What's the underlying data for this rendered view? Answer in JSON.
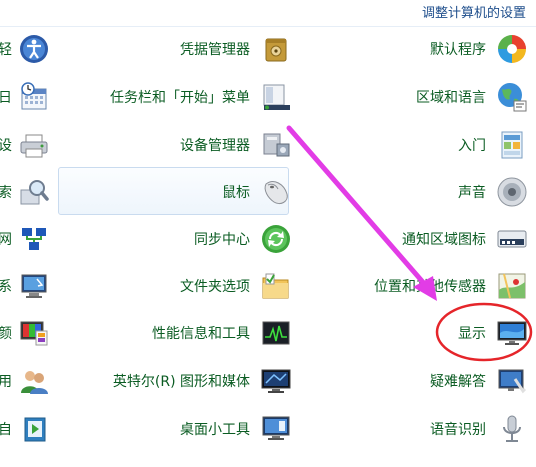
{
  "header": {
    "title": "调整计算机的设置"
  },
  "right_column": [
    {
      "label": "默认程序",
      "icon": "default-programs-icon"
    },
    {
      "label": "区域和语言",
      "icon": "region-language-icon"
    },
    {
      "label": "入门",
      "icon": "getting-started-icon"
    },
    {
      "label": "声音",
      "icon": "sound-icon"
    },
    {
      "label": "通知区域图标",
      "icon": "notification-area-icon"
    },
    {
      "label": "位置和其他传感器",
      "icon": "location-sensors-icon"
    },
    {
      "label": "显示",
      "icon": "display-icon"
    },
    {
      "label": "疑难解答",
      "icon": "troubleshooting-icon"
    },
    {
      "label": "语音识别",
      "icon": "speech-recognition-icon"
    }
  ],
  "middle_column": [
    {
      "label": "凭据管理器",
      "icon": "credential-manager-icon"
    },
    {
      "label": "任务栏和「开始」菜单",
      "icon": "taskbar-start-menu-icon"
    },
    {
      "label": "设备管理器",
      "icon": "device-manager-icon"
    },
    {
      "label": "鼠标",
      "icon": "mouse-icon"
    },
    {
      "label": "同步中心",
      "icon": "sync-center-icon"
    },
    {
      "label": "文件夹选项",
      "icon": "folder-options-icon"
    },
    {
      "label": "性能信息和工具",
      "icon": "performance-tools-icon"
    },
    {
      "label": "英特尔(R) 图形和媒体",
      "icon": "intel-graphics-icon"
    },
    {
      "label": "桌面小工具",
      "icon": "desktop-gadgets-icon"
    }
  ],
  "left_column": [
    {
      "label": "轻",
      "icon": "ease-of-access-icon"
    },
    {
      "label": "日",
      "icon": "date-time-icon"
    },
    {
      "label": "设",
      "icon": "devices-printers-icon"
    },
    {
      "label": "索",
      "icon": "indexing-options-icon"
    },
    {
      "label": "网",
      "icon": "network-sharing-icon"
    },
    {
      "label": "系",
      "icon": "system-icon"
    },
    {
      "label": "颜",
      "icon": "color-management-icon"
    },
    {
      "label": "用",
      "icon": "user-accounts-icon"
    },
    {
      "label": "自",
      "icon": "autoplay-icon"
    }
  ],
  "annotation": {
    "arrow_color": "#e23ce6",
    "circle_color": "#e5252a"
  }
}
